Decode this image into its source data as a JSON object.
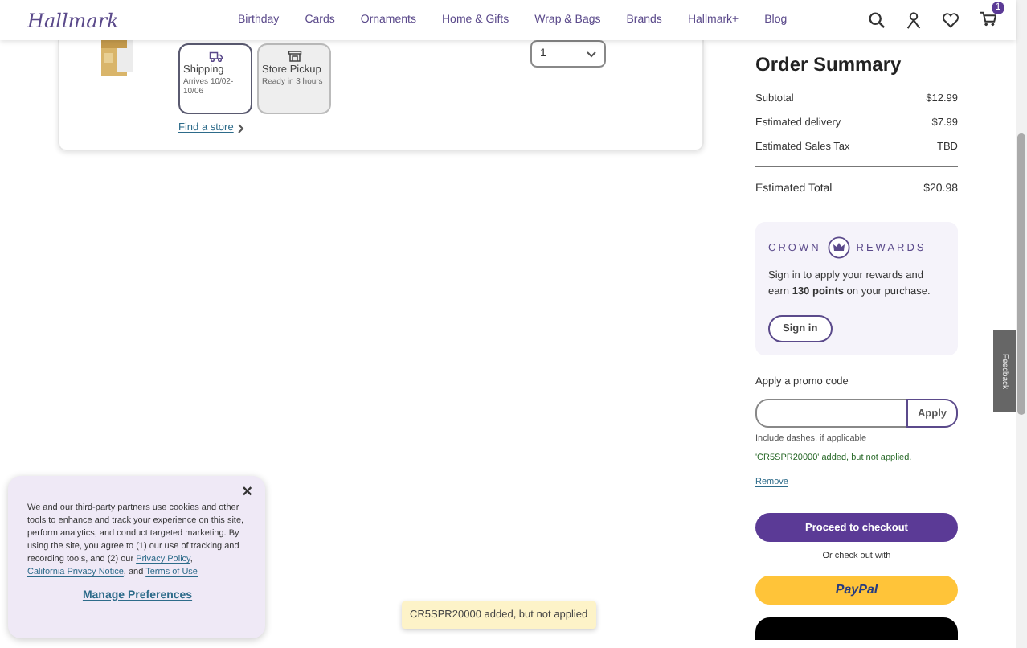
{
  "header": {
    "logo": "Hallmark",
    "nav": [
      "Birthday",
      "Cards",
      "Ornaments",
      "Home & Gifts",
      "Wrap & Bags",
      "Brands",
      "Hallmark+",
      "Blog"
    ],
    "cart_count": "1"
  },
  "cart_item": {
    "quantity": "1",
    "delivery_options": [
      {
        "title": "Shipping",
        "detail": "Arrives 10/02-10/06",
        "selected": true
      },
      {
        "title": "Store Pickup",
        "detail": "Ready in 3 hours",
        "selected": false
      }
    ],
    "find_store": "Find a store"
  },
  "order_summary": {
    "title": "Order Summary",
    "rows": [
      {
        "label": "Subtotal",
        "value": "$12.99"
      },
      {
        "label": "Estimated delivery",
        "value": "$7.99"
      },
      {
        "label": "Estimated Sales Tax",
        "value": "TBD"
      }
    ],
    "total": {
      "label": "Estimated Total",
      "value": "$20.98"
    }
  },
  "rewards": {
    "brand_left": "CROWN",
    "brand_right": "REWARDS",
    "message": "Sign in to apply your rewards and earn **130 points** on your purchase.",
    "button": "Sign in"
  },
  "promo": {
    "label": "Apply a promo code",
    "button": "Apply",
    "hint": "Include dashes, if applicable",
    "status": "'CR5SPR20000' added, but not applied.",
    "remove": "Remove"
  },
  "checkout": {
    "button": "Proceed to checkout",
    "alternate": "Or check out with",
    "paypal": "PayPal"
  },
  "feedback_tab": "Feedback",
  "cookie_banner": {
    "close": "×",
    "parts": [
      {
        "kind": "text",
        "text": "We and our third-party partners use cookies and other tools to enhance and track your experience on this site, perform analytics, and conduct targeted marketing. By using the site, you agree to (1) our use of tracking and recording tools, and (2) our "
      },
      {
        "kind": "link",
        "text": "Privacy Policy"
      },
      {
        "kind": "text",
        "text": ", "
      },
      {
        "kind": "link",
        "text": "California Privacy Notice"
      },
      {
        "kind": "text",
        "text": ", and "
      },
      {
        "kind": "link",
        "text": "Terms of Use"
      }
    ],
    "manage": "Manage Preferences"
  },
  "toast": "CR5SPR20000 added, but not applied"
}
